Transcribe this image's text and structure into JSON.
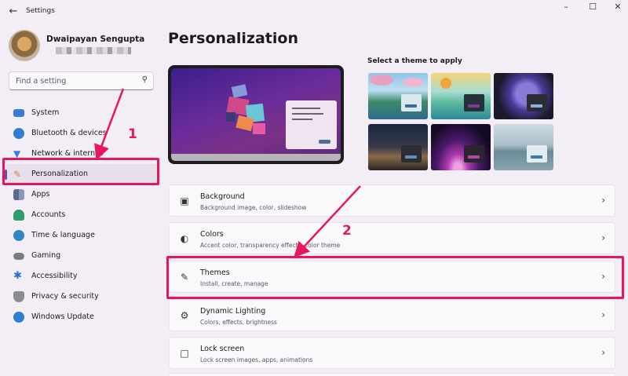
{
  "window": {
    "title": "Settings",
    "controls": {
      "minimize": "–",
      "maximize": "☐",
      "close": "✕"
    }
  },
  "profile": {
    "name": "Dwaipayan Sengupta"
  },
  "search": {
    "placeholder": "Find a setting"
  },
  "nav": {
    "items": [
      {
        "label": "System",
        "icon": "monitor-icon",
        "color": "#3a7bd5"
      },
      {
        "label": "Bluetooth & devices",
        "icon": "bluetooth-icon",
        "color": "#2f7fd1"
      },
      {
        "label": "Network & internet",
        "icon": "wifi-icon",
        "color": "#3c80d8"
      },
      {
        "label": "Personalization",
        "icon": "brush-icon",
        "color": "#d9823a",
        "active": true
      },
      {
        "label": "Apps",
        "icon": "apps-icon",
        "color": "#5a6b8c"
      },
      {
        "label": "Accounts",
        "icon": "person-icon",
        "color": "#2f9a6a"
      },
      {
        "label": "Time & language",
        "icon": "globe-clock-icon",
        "color": "#2f86c9"
      },
      {
        "label": "Gaming",
        "icon": "gamepad-icon",
        "color": "#7a7a80"
      },
      {
        "label": "Accessibility",
        "icon": "accessibility-icon",
        "color": "#2a6fd0"
      },
      {
        "label": "Privacy & security",
        "icon": "shield-icon",
        "color": "#8a8a90"
      },
      {
        "label": "Windows Update",
        "icon": "update-icon",
        "color": "#2f7fd1"
      }
    ]
  },
  "main": {
    "title": "Personalization",
    "themes_label": "Select a theme to apply",
    "themes": [
      {
        "icon": "theme-cherry-blossom-icon"
      },
      {
        "icon": "theme-island-sunrise-icon"
      },
      {
        "icon": "theme-dark-bloom-icon"
      },
      {
        "icon": "theme-night-sky-icon"
      },
      {
        "icon": "theme-glow-icon"
      },
      {
        "icon": "theme-lake-icon"
      }
    ],
    "cards": [
      {
        "title": "Background",
        "subtitle": "Background image, color, slideshow",
        "icon": "image-icon"
      },
      {
        "title": "Colors",
        "subtitle": "Accent color, transparency effects, color theme",
        "icon": "palette-icon"
      },
      {
        "title": "Themes",
        "subtitle": "Install, create, manage",
        "icon": "pen-icon"
      },
      {
        "title": "Dynamic Lighting",
        "subtitle": "Colors, effects, brightness",
        "icon": "gear-icon"
      },
      {
        "title": "Lock screen",
        "subtitle": "Lock screen images, apps, animations",
        "icon": "lock-screen-icon"
      }
    ]
  },
  "annotations": {
    "step1": "1",
    "step2": "2",
    "accent": "#e8175d"
  }
}
